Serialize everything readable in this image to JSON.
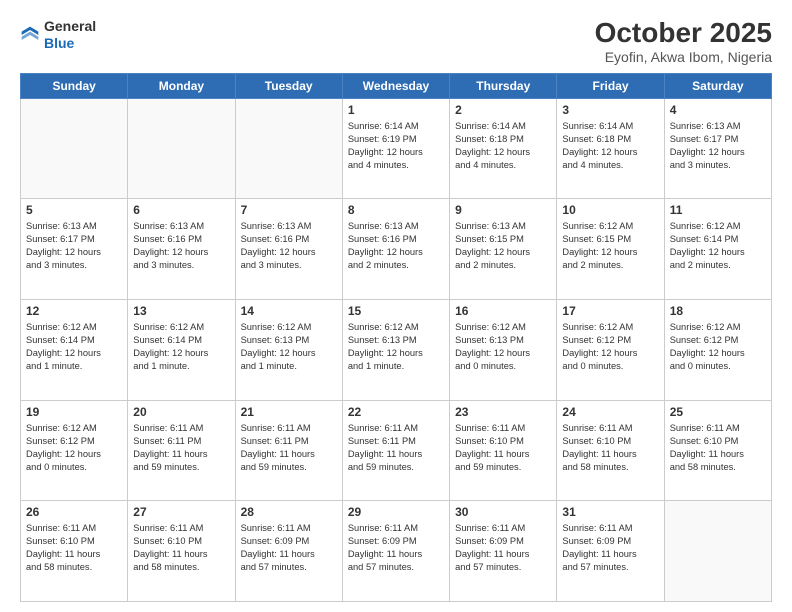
{
  "header": {
    "logo_line1": "General",
    "logo_line2": "Blue",
    "month": "October 2025",
    "location": "Eyofin, Akwa Ibom, Nigeria"
  },
  "weekdays": [
    "Sunday",
    "Monday",
    "Tuesday",
    "Wednesday",
    "Thursday",
    "Friday",
    "Saturday"
  ],
  "weeks": [
    [
      {
        "day": "",
        "info": ""
      },
      {
        "day": "",
        "info": ""
      },
      {
        "day": "",
        "info": ""
      },
      {
        "day": "1",
        "info": "Sunrise: 6:14 AM\nSunset: 6:19 PM\nDaylight: 12 hours\nand 4 minutes."
      },
      {
        "day": "2",
        "info": "Sunrise: 6:14 AM\nSunset: 6:18 PM\nDaylight: 12 hours\nand 4 minutes."
      },
      {
        "day": "3",
        "info": "Sunrise: 6:14 AM\nSunset: 6:18 PM\nDaylight: 12 hours\nand 4 minutes."
      },
      {
        "day": "4",
        "info": "Sunrise: 6:13 AM\nSunset: 6:17 PM\nDaylight: 12 hours\nand 3 minutes."
      }
    ],
    [
      {
        "day": "5",
        "info": "Sunrise: 6:13 AM\nSunset: 6:17 PM\nDaylight: 12 hours\nand 3 minutes."
      },
      {
        "day": "6",
        "info": "Sunrise: 6:13 AM\nSunset: 6:16 PM\nDaylight: 12 hours\nand 3 minutes."
      },
      {
        "day": "7",
        "info": "Sunrise: 6:13 AM\nSunset: 6:16 PM\nDaylight: 12 hours\nand 3 minutes."
      },
      {
        "day": "8",
        "info": "Sunrise: 6:13 AM\nSunset: 6:16 PM\nDaylight: 12 hours\nand 2 minutes."
      },
      {
        "day": "9",
        "info": "Sunrise: 6:13 AM\nSunset: 6:15 PM\nDaylight: 12 hours\nand 2 minutes."
      },
      {
        "day": "10",
        "info": "Sunrise: 6:12 AM\nSunset: 6:15 PM\nDaylight: 12 hours\nand 2 minutes."
      },
      {
        "day": "11",
        "info": "Sunrise: 6:12 AM\nSunset: 6:14 PM\nDaylight: 12 hours\nand 2 minutes."
      }
    ],
    [
      {
        "day": "12",
        "info": "Sunrise: 6:12 AM\nSunset: 6:14 PM\nDaylight: 12 hours\nand 1 minute."
      },
      {
        "day": "13",
        "info": "Sunrise: 6:12 AM\nSunset: 6:14 PM\nDaylight: 12 hours\nand 1 minute."
      },
      {
        "day": "14",
        "info": "Sunrise: 6:12 AM\nSunset: 6:13 PM\nDaylight: 12 hours\nand 1 minute."
      },
      {
        "day": "15",
        "info": "Sunrise: 6:12 AM\nSunset: 6:13 PM\nDaylight: 12 hours\nand 1 minute."
      },
      {
        "day": "16",
        "info": "Sunrise: 6:12 AM\nSunset: 6:13 PM\nDaylight: 12 hours\nand 0 minutes."
      },
      {
        "day": "17",
        "info": "Sunrise: 6:12 AM\nSunset: 6:12 PM\nDaylight: 12 hours\nand 0 minutes."
      },
      {
        "day": "18",
        "info": "Sunrise: 6:12 AM\nSunset: 6:12 PM\nDaylight: 12 hours\nand 0 minutes."
      }
    ],
    [
      {
        "day": "19",
        "info": "Sunrise: 6:12 AM\nSunset: 6:12 PM\nDaylight: 12 hours\nand 0 minutes."
      },
      {
        "day": "20",
        "info": "Sunrise: 6:11 AM\nSunset: 6:11 PM\nDaylight: 11 hours\nand 59 minutes."
      },
      {
        "day": "21",
        "info": "Sunrise: 6:11 AM\nSunset: 6:11 PM\nDaylight: 11 hours\nand 59 minutes."
      },
      {
        "day": "22",
        "info": "Sunrise: 6:11 AM\nSunset: 6:11 PM\nDaylight: 11 hours\nand 59 minutes."
      },
      {
        "day": "23",
        "info": "Sunrise: 6:11 AM\nSunset: 6:10 PM\nDaylight: 11 hours\nand 59 minutes."
      },
      {
        "day": "24",
        "info": "Sunrise: 6:11 AM\nSunset: 6:10 PM\nDaylight: 11 hours\nand 58 minutes."
      },
      {
        "day": "25",
        "info": "Sunrise: 6:11 AM\nSunset: 6:10 PM\nDaylight: 11 hours\nand 58 minutes."
      }
    ],
    [
      {
        "day": "26",
        "info": "Sunrise: 6:11 AM\nSunset: 6:10 PM\nDaylight: 11 hours\nand 58 minutes."
      },
      {
        "day": "27",
        "info": "Sunrise: 6:11 AM\nSunset: 6:10 PM\nDaylight: 11 hours\nand 58 minutes."
      },
      {
        "day": "28",
        "info": "Sunrise: 6:11 AM\nSunset: 6:09 PM\nDaylight: 11 hours\nand 57 minutes."
      },
      {
        "day": "29",
        "info": "Sunrise: 6:11 AM\nSunset: 6:09 PM\nDaylight: 11 hours\nand 57 minutes."
      },
      {
        "day": "30",
        "info": "Sunrise: 6:11 AM\nSunset: 6:09 PM\nDaylight: 11 hours\nand 57 minutes."
      },
      {
        "day": "31",
        "info": "Sunrise: 6:11 AM\nSunset: 6:09 PM\nDaylight: 11 hours\nand 57 minutes."
      },
      {
        "day": "",
        "info": ""
      }
    ]
  ]
}
